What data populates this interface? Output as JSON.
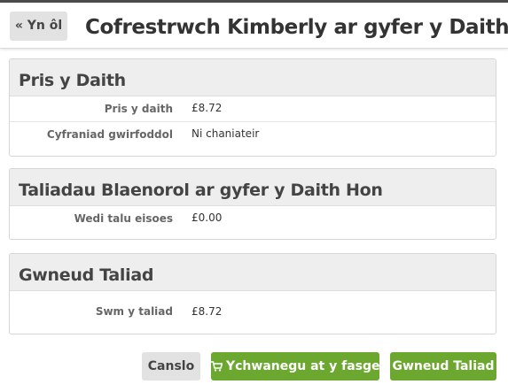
{
  "header": {
    "back_label": "« Yn ôl",
    "title": "Cofrestrwch Kimberly ar gyfer y Daith"
  },
  "sections": [
    {
      "heading": "Pris y Daith",
      "rows": [
        {
          "label": "Pris y daith",
          "value": "£8.72"
        },
        {
          "label": "Cyfraniad gwirfoddol",
          "value": "Ni chaniateir"
        }
      ]
    },
    {
      "heading": "Taliadau Blaenorol ar gyfer y Daith Hon",
      "rows": [
        {
          "label": "Wedi talu eisoes",
          "value": "£0.00"
        }
      ]
    },
    {
      "heading": "Gwneud Taliad",
      "rows": [
        {
          "label": "Swm y taliad",
          "value": "£8.72"
        }
      ]
    }
  ],
  "actions": {
    "cancel_label": "Canslo",
    "add_to_basket_label": "Ychwanegu at y fasged",
    "pay_label": "Gwneud Taliad",
    "cart_icon": "shopping-cart-icon"
  },
  "colors": {
    "primary_green": "#6ca830",
    "secondary_grey": "#e2e2e2",
    "panel_header": "#eeeeee"
  }
}
